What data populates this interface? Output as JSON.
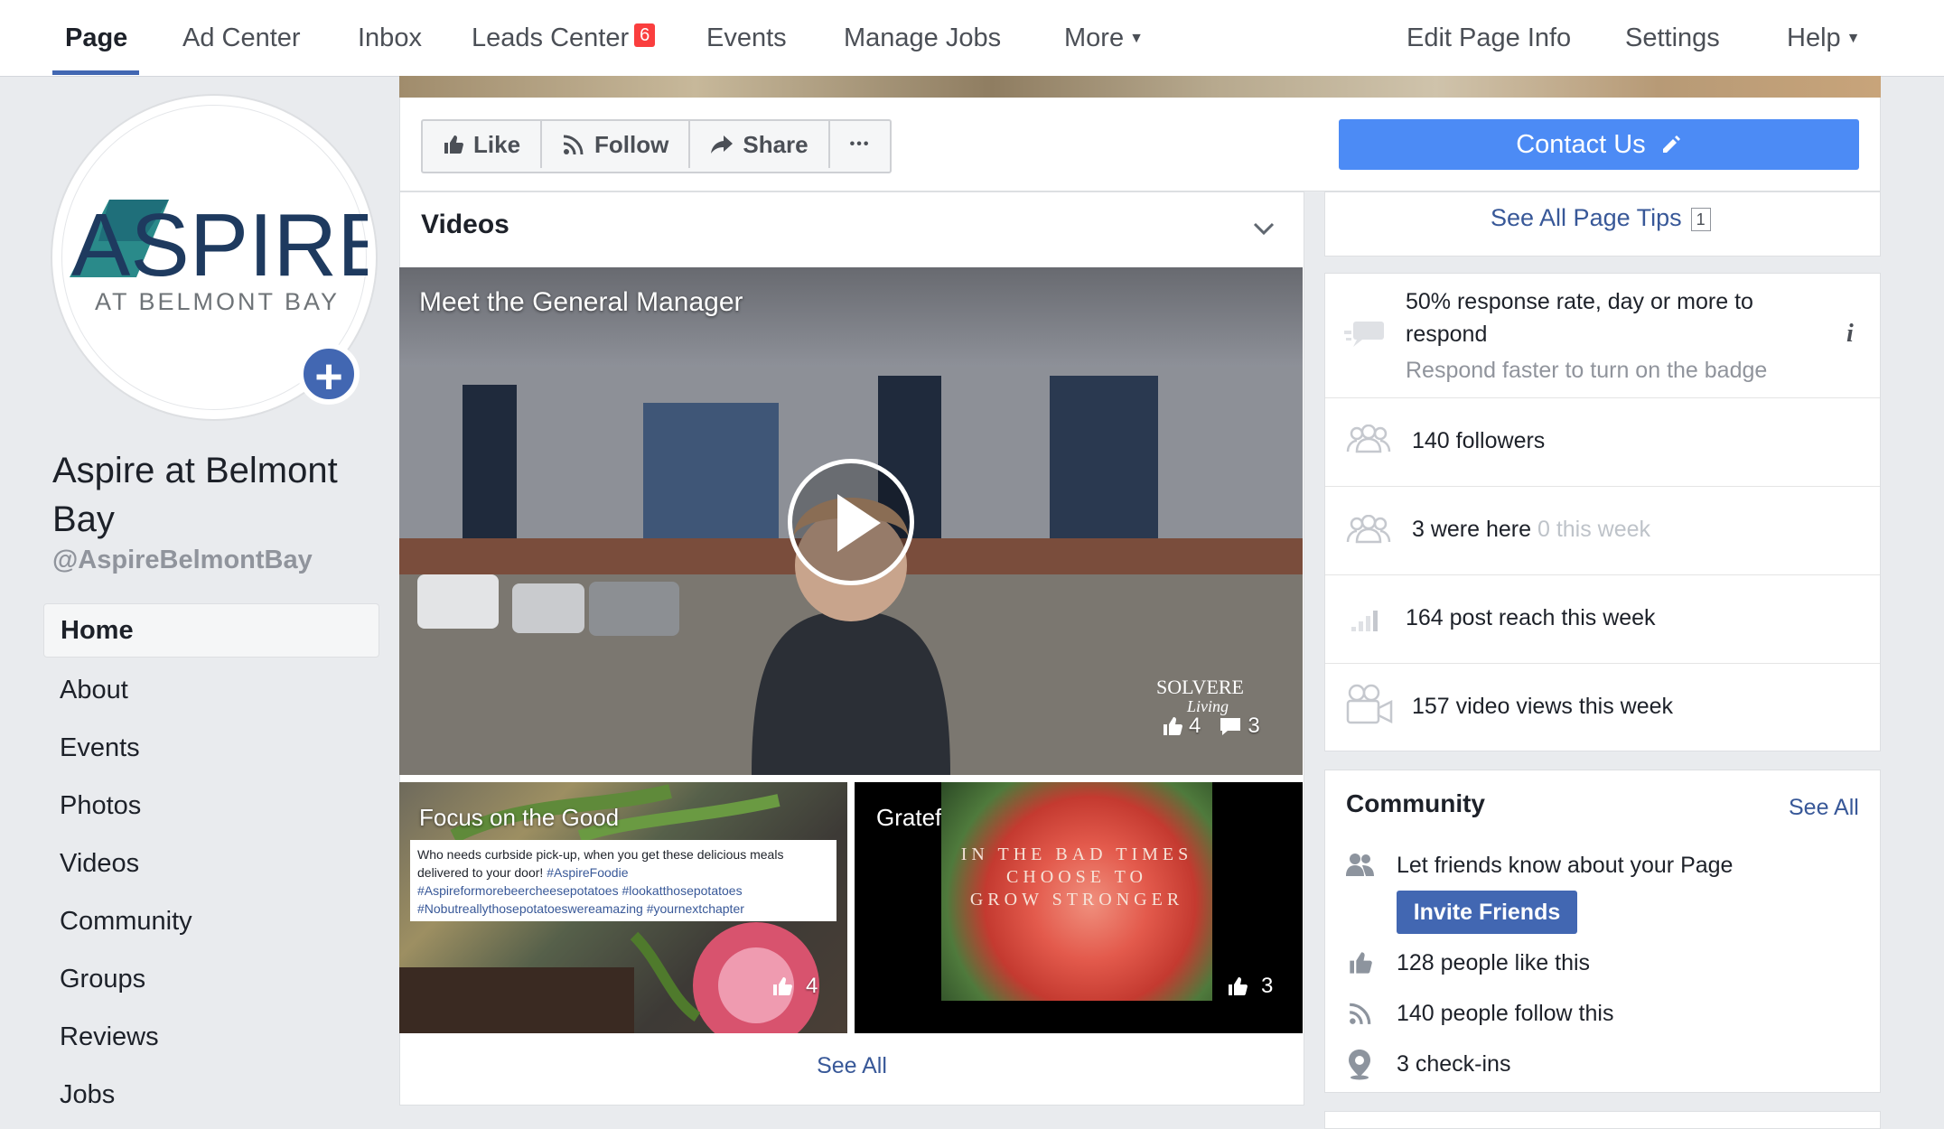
{
  "topnav": {
    "items": [
      "Page",
      "Ad Center",
      "Inbox",
      "Leads Center",
      "Events",
      "Manage Jobs",
      "More",
      "Edit Page Info",
      "Settings",
      "Help"
    ],
    "leads_badge": "6"
  },
  "page": {
    "logo_word": "ASPIRE",
    "logo_sub": "AT BELMONT BAY",
    "name": "Aspire at Belmont Bay",
    "handle": "@AspireBelmontBay"
  },
  "leftnav": [
    "Home",
    "About",
    "Events",
    "Photos",
    "Videos",
    "Community",
    "Groups",
    "Reviews",
    "Jobs"
  ],
  "actions": {
    "like": "Like",
    "follow": "Follow",
    "share": "Share",
    "more": "•••",
    "contact": "Contact Us"
  },
  "videos": {
    "title": "Videos",
    "main": {
      "title": "Meet the General Manager",
      "watermark": "SOLVERE",
      "watermark_sub": "Living",
      "likes": "4",
      "comments": "3"
    },
    "thumb1": {
      "title": "Focus on the Good",
      "caption_text": "Who needs curbside pick-up, when you get these delicious meals delivered to your door!",
      "caption_tags": "#AspireFoodie #Aspireformorebeercheesepotatoes #lookatthosepotatoes #Nobutreallythosepotatoeswereamazing #yournextchapter",
      "likes": "4"
    },
    "thumb2": {
      "title": "Grateful",
      "overlay": [
        "IN THE BAD TIMES",
        "CHOOSE TO",
        "GROW STRONGER"
      ],
      "likes": "3"
    },
    "see_all": "See All"
  },
  "right": {
    "tips": "See All Page Tips",
    "tips_count": "1",
    "response_line1": "50% response rate, day or more to",
    "response_line2": "respond",
    "response_sub": "Respond faster to turn on the badge",
    "followers": "140 followers",
    "were_here": "3 were here",
    "were_here_week": "0 this week",
    "post_reach": "164 post reach this week",
    "video_views": "157 video views this week"
  },
  "community": {
    "title": "Community",
    "see_all": "See All",
    "invite_prompt": "Let friends know about your Page",
    "invite_button": "Invite Friends",
    "likes": "128 people like this",
    "follows": "140 people follow this",
    "checkins": "3 check-ins"
  },
  "colors": {
    "brand_blue": "#4267b2",
    "contact_blue": "#4c8bf5",
    "link": "#385898",
    "logo_teal": "#2a8a8a",
    "logo_navy": "#1e3a5f"
  }
}
